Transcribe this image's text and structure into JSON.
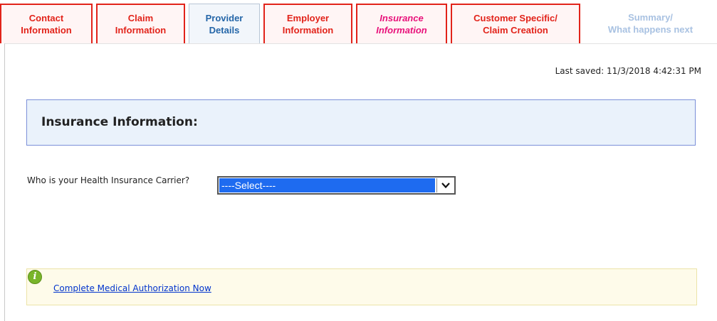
{
  "tabs": [
    {
      "label": "Contact\nInformation",
      "style": "red",
      "text_color": "#e2231a"
    },
    {
      "label": "Claim\nInformation",
      "style": "red",
      "text_color": "#e2231a"
    },
    {
      "label": "Provider\nDetails",
      "style": "blue",
      "text_color": "#2466a8"
    },
    {
      "label": "Employer\nInformation",
      "style": "red",
      "text_color": "#e2231a"
    },
    {
      "label": "Insurance\nInformation",
      "style": "current",
      "text_color": "#e8117a"
    },
    {
      "label": "Customer Specific/\nClaim Creation",
      "style": "red",
      "text_color": "#e2231a"
    },
    {
      "label": "Summary/\nWhat happens next",
      "style": "plain",
      "text_color": "#a9c2e2"
    }
  ],
  "last_saved": "Last saved: 11/3/2018 4:42:31 PM",
  "section": {
    "title": "Insurance Information:"
  },
  "form": {
    "carrier_label": "Who is your Health Insurance Carrier?",
    "carrier_selected": "----Select----",
    "arrow_icon": "chevron-down-icon"
  },
  "info": {
    "icon": "info-icon",
    "icon_glyph": "i",
    "link_text": "Complete Medical Authorization Now"
  },
  "colors": {
    "tab_border_red": "#e2231a",
    "header_background": "#eaf2fb",
    "header_border": "#7b8fd8",
    "select_highlight": "#1e6bf0",
    "info_background": "#fefbea",
    "info_icon": "#79b52a",
    "link": "#0033cc"
  }
}
